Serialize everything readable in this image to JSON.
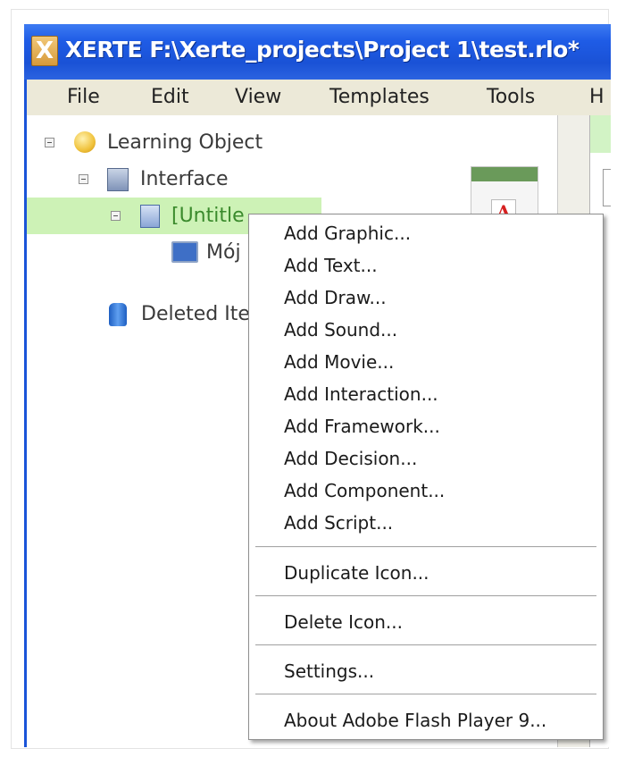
{
  "window": {
    "title": "XERTE F:\\Xerte_projects\\Project 1\\test.rlo*",
    "app_icon": "X"
  },
  "menubar": [
    "File",
    "Edit",
    "View",
    "Templates",
    "Tools",
    "H"
  ],
  "tree": [
    {
      "label": "Learning Object",
      "icon": "learning-object-icon",
      "expanded": true
    },
    {
      "label": "Interface",
      "icon": "interface-icon",
      "expanded": true
    },
    {
      "label": "[Untitle",
      "icon": "page-icon",
      "expanded": true,
      "selected": true
    },
    {
      "label": "Mój",
      "icon": "monitor-icon"
    },
    {
      "label": "Deleted Ite",
      "icon": "deleted-items-icon"
    }
  ],
  "side_panel": {
    "icon": "A"
  },
  "context_menu": {
    "groups": [
      [
        "Add Graphic...",
        "Add Text...",
        "Add Draw...",
        "Add Sound...",
        "Add Movie...",
        "Add Interaction...",
        "Add Framework...",
        "Add Decision...",
        "Add Component...",
        "Add Script..."
      ],
      [
        "Duplicate Icon..."
      ],
      [
        "Delete Icon..."
      ],
      [
        "Settings..."
      ],
      [
        "About Adobe Flash Player 9..."
      ]
    ]
  }
}
